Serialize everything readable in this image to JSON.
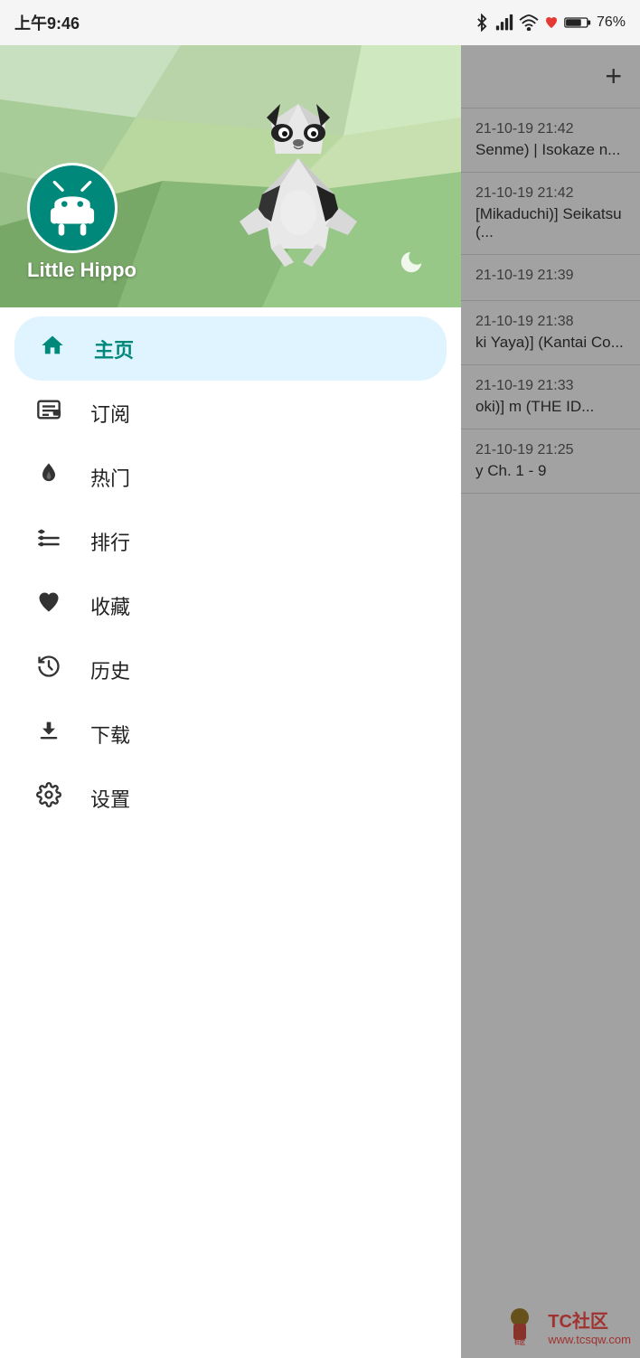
{
  "statusBar": {
    "time": "上午9:46",
    "battery": "76%",
    "icons": [
      "bluetooth",
      "signal",
      "wifi",
      "battery"
    ]
  },
  "drawer": {
    "username": "Little Hippo",
    "nightModeIcon": "🌙",
    "navItems": [
      {
        "id": "home",
        "label": "主页",
        "icon": "🏠",
        "active": true
      },
      {
        "id": "subscribe",
        "label": "订阅",
        "icon": "📋",
        "active": false
      },
      {
        "id": "hot",
        "label": "热门",
        "icon": "🔥",
        "active": false
      },
      {
        "id": "ranking",
        "label": "排行",
        "icon": "≔",
        "active": false
      },
      {
        "id": "favorites",
        "label": "收藏",
        "icon": "♥",
        "active": false
      },
      {
        "id": "history",
        "label": "历史",
        "icon": "⟳",
        "active": false
      },
      {
        "id": "download",
        "label": "下载",
        "icon": "⬇",
        "active": false
      },
      {
        "id": "settings",
        "label": "设置",
        "icon": "⚙",
        "active": false
      }
    ]
  },
  "rightPanel": {
    "addButtonLabel": "+",
    "listItems": [
      {
        "time": "21-10-19 21:42",
        "title": "Senme) | Isokaze n..."
      },
      {
        "time": "21-10-19 21:42",
        "title": "[Mikaduchi)] Seikatsu (..."
      },
      {
        "time": "21-10-19 21:39",
        "title": ""
      },
      {
        "time": "21-10-19 21:38",
        "title": "ki Yaya)] (Kantai Co..."
      },
      {
        "time": "21-10-19 21:33",
        "title": "oki)] m (THE ID..."
      },
      {
        "time": "21-10-19 21:25",
        "title": "y Ch. 1 - 9"
      }
    ]
  },
  "watermark": {
    "text": "TC社区",
    "url": "www.tcsqw.com"
  }
}
